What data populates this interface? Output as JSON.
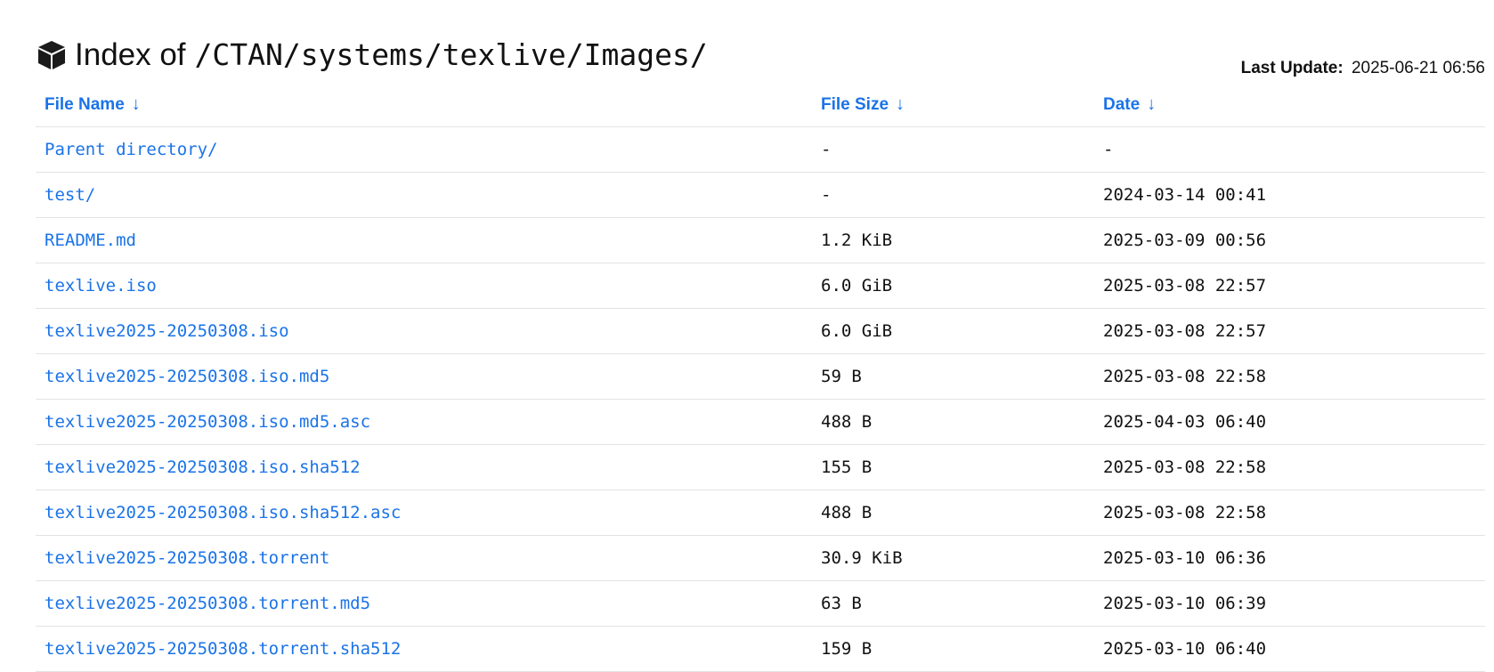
{
  "header": {
    "title_prefix": "Index of",
    "path": "/CTAN/systems/texlive/Images/",
    "last_update_label": "Last Update:",
    "last_update_value": "2025-06-21 06:56",
    "icon": "box-icon"
  },
  "table": {
    "columns": [
      {
        "label": "File Name",
        "arrow": "↓"
      },
      {
        "label": "File Size",
        "arrow": "↓"
      },
      {
        "label": "Date",
        "arrow": "↓"
      }
    ],
    "rows": [
      {
        "name": "Parent directory/",
        "size": "-",
        "date": "-"
      },
      {
        "name": "test/",
        "size": "-",
        "date": "2024-03-14 00:41"
      },
      {
        "name": "README.md",
        "size": "1.2 KiB",
        "date": "2025-03-09 00:56"
      },
      {
        "name": "texlive.iso",
        "size": "6.0 GiB",
        "date": "2025-03-08 22:57"
      },
      {
        "name": "texlive2025-20250308.iso",
        "size": "6.0 GiB",
        "date": "2025-03-08 22:57"
      },
      {
        "name": "texlive2025-20250308.iso.md5",
        "size": "59 B",
        "date": "2025-03-08 22:58"
      },
      {
        "name": "texlive2025-20250308.iso.md5.asc",
        "size": "488 B",
        "date": "2025-04-03 06:40"
      },
      {
        "name": "texlive2025-20250308.iso.sha512",
        "size": "155 B",
        "date": "2025-03-08 22:58"
      },
      {
        "name": "texlive2025-20250308.iso.sha512.asc",
        "size": "488 B",
        "date": "2025-03-08 22:58"
      },
      {
        "name": "texlive2025-20250308.torrent",
        "size": "30.9 KiB",
        "date": "2025-03-10 06:36"
      },
      {
        "name": "texlive2025-20250308.torrent.md5",
        "size": "63 B",
        "date": "2025-03-10 06:39"
      },
      {
        "name": "texlive2025-20250308.torrent.sha512",
        "size": "159 B",
        "date": "2025-03-10 06:40"
      }
    ]
  },
  "colors": {
    "link": "#1a73e8",
    "text": "#111111",
    "divider": "#e3e3e3"
  }
}
